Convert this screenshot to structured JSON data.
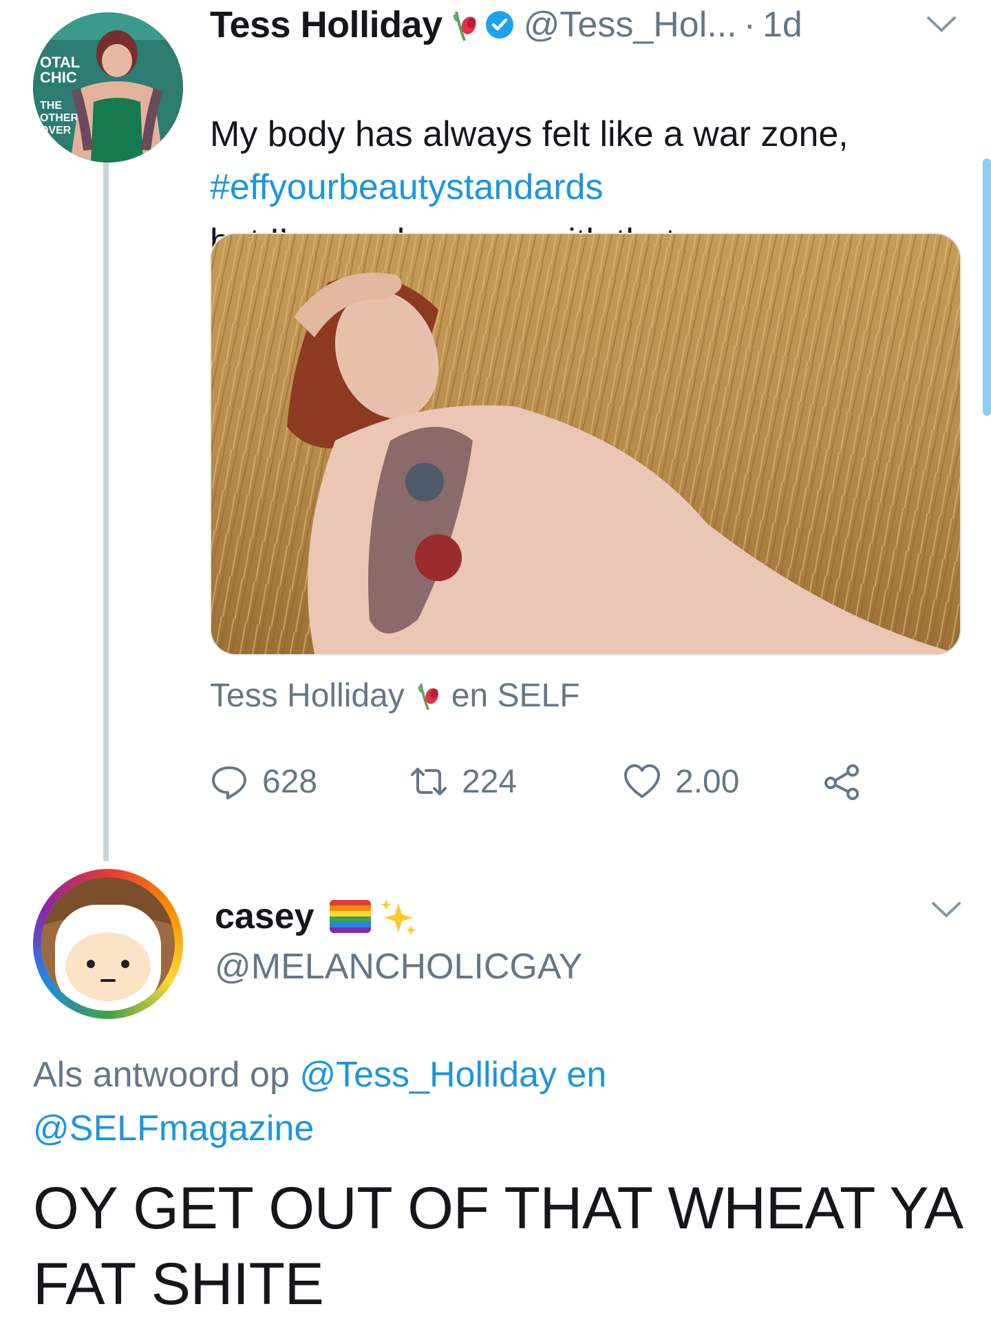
{
  "scrollbar": {
    "color": "#8ecdf2"
  },
  "thread": {
    "line_color": "#c8d4dd"
  },
  "tweet": {
    "author_name": "Tess Holliday",
    "name_emoji": "wilted-rose-emoji",
    "verified_icon": "verified-badge-icon",
    "handle": "@Tess_Hol...",
    "separator": "·",
    "time": "1d",
    "text_line1": "My body has always felt like a war zone,",
    "text_line2": "but I’ve made peace with that.",
    "hashtag": "#effyourbeautystandards",
    "attribution": {
      "name": "Tess Holliday",
      "suffix": "en SELF"
    },
    "actions": {
      "replies": "628",
      "retweets": "224",
      "likes": "2.00",
      "reply_icon": "reply-icon",
      "retweet_icon": "retweet-icon",
      "like_icon": "heart-icon",
      "share_icon": "share-icon"
    },
    "menu_icon": "chevron-down-icon"
  },
  "reply": {
    "author_name": "casey",
    "name_emojis": [
      "rainbow-flag-emoji",
      "sparkles-emoji"
    ],
    "handle": "@MELANCHOLICGAY",
    "context_prefix": "Als antwoord op",
    "context_mention1": "@Tess_Holliday",
    "context_join": "en",
    "context_mention2": "@SELFmagazine",
    "text": "OY GET OUT OF THAT WHEAT YA FAT SHITE",
    "menu_icon": "chevron-down-icon"
  },
  "colors": {
    "link": "#1b95e0",
    "muted": "#657786",
    "text": "#14171a",
    "verified": "#1da1f2"
  }
}
